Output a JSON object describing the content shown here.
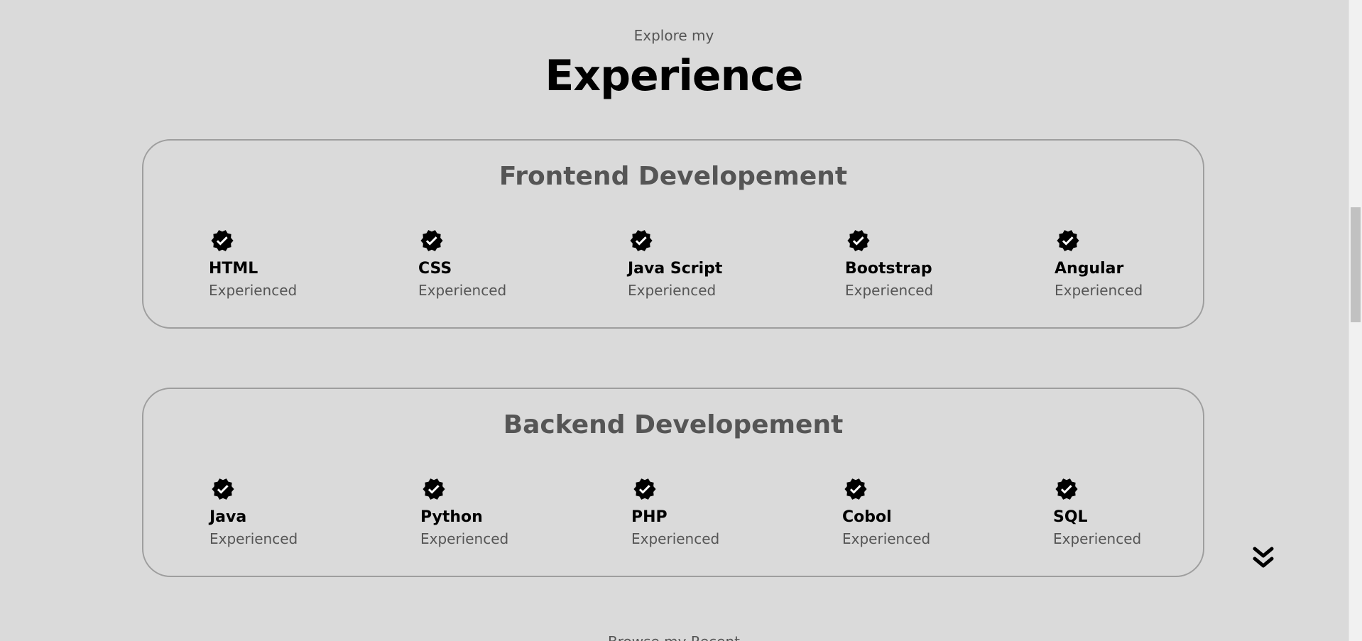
{
  "header": {
    "subtitle": "Explore my",
    "title": "Experience"
  },
  "cards": [
    {
      "title": "Frontend Developement",
      "skills": [
        {
          "name": "HTML",
          "level": "Experienced"
        },
        {
          "name": "CSS",
          "level": "Experienced"
        },
        {
          "name": "Java Script",
          "level": "Experienced"
        },
        {
          "name": "Bootstrap",
          "level": "Experienced"
        },
        {
          "name": "Angular",
          "level": "Experienced"
        }
      ]
    },
    {
      "title": "Backend Developement",
      "skills": [
        {
          "name": "Java",
          "level": "Experienced"
        },
        {
          "name": "Python",
          "level": "Experienced"
        },
        {
          "name": "PHP",
          "level": "Experienced"
        },
        {
          "name": "Cobol",
          "level": "Experienced"
        },
        {
          "name": "SQL",
          "level": "Experienced"
        }
      ]
    }
  ],
  "icons": {
    "skill_badge": "verified-check-badge-icon",
    "scroll_down": "double-chevron-down-icon"
  },
  "colors": {
    "background": "#dadada",
    "title": "#000000",
    "muted_text": "#555555",
    "card_border": "#9e9e9e"
  },
  "next_section": {
    "subtitle": "Browse my Recent"
  }
}
